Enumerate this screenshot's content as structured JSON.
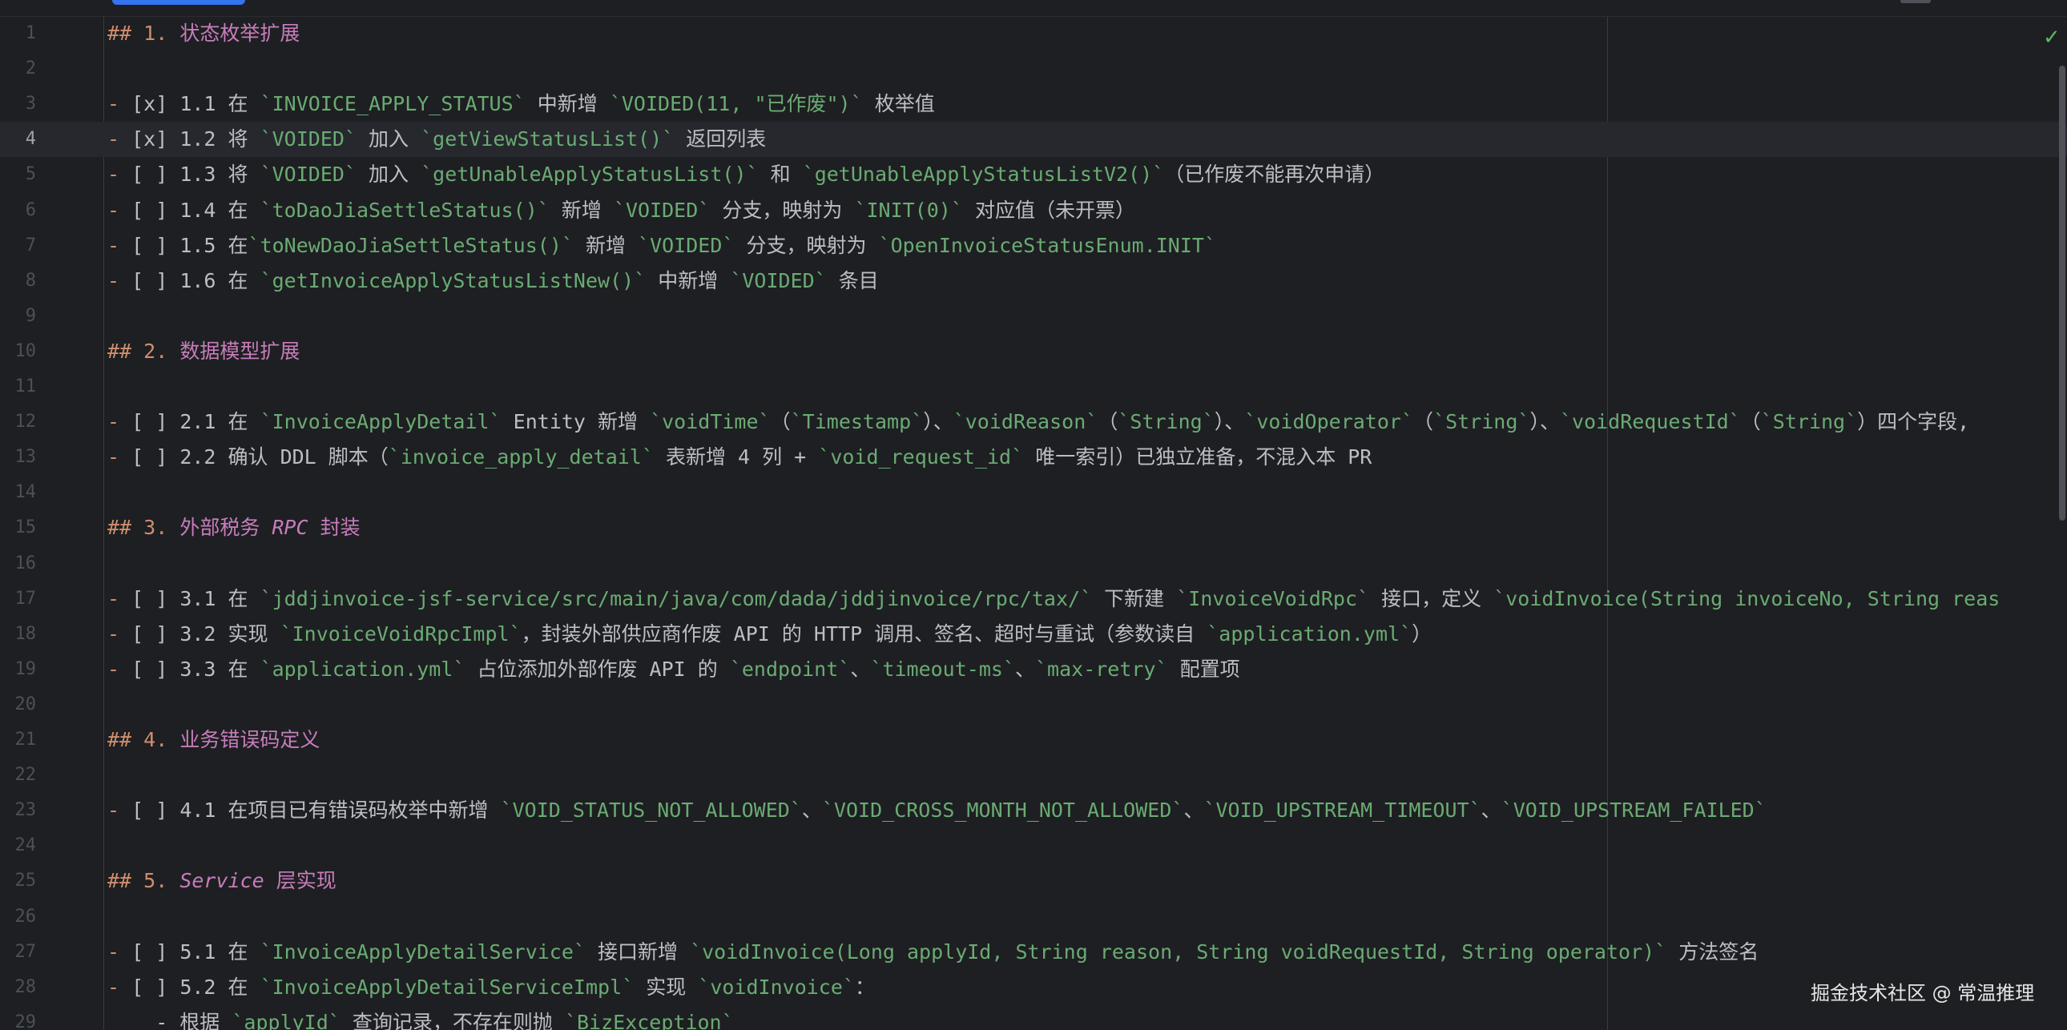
{
  "editor": {
    "lines": [
      {
        "n": "1",
        "parts": [
          {
            "c": "h",
            "t": "## 1. "
          },
          {
            "c": "hh",
            "t": "状态枚举扩展"
          }
        ]
      },
      {
        "n": "2",
        "parts": []
      },
      {
        "n": "3",
        "parts": [
          {
            "c": "b",
            "t": "- "
          },
          {
            "c": "t",
            "t": "[x] 1.1 在 "
          },
          {
            "c": "s",
            "t": "`INVOICE_APPLY_STATUS`"
          },
          {
            "c": "t",
            "t": " 中新增 "
          },
          {
            "c": "s",
            "t": "`VOIDED(11, \"已作废\")`"
          },
          {
            "c": "t",
            "t": " 枚举值"
          }
        ]
      },
      {
        "n": "4",
        "current": true,
        "parts": [
          {
            "c": "b",
            "t": "- "
          },
          {
            "c": "t",
            "t": "[x] 1.2 将 "
          },
          {
            "c": "s",
            "t": "`VOIDED`"
          },
          {
            "c": "t",
            "t": " 加入 "
          },
          {
            "c": "s",
            "t": "`getViewStatusList()`"
          },
          {
            "c": "t",
            "t": " 返回列表"
          }
        ]
      },
      {
        "n": "5",
        "parts": [
          {
            "c": "b",
            "t": "- "
          },
          {
            "c": "t",
            "t": "[ ] 1.3 将 "
          },
          {
            "c": "s",
            "t": "`VOIDED`"
          },
          {
            "c": "t",
            "t": " 加入 "
          },
          {
            "c": "s",
            "t": "`getUnableApplyStatusList()`"
          },
          {
            "c": "t",
            "t": " 和 "
          },
          {
            "c": "s",
            "t": "`getUnableApplyStatusListV2()`"
          },
          {
            "c": "t",
            "t": "（已作废不能再次申请）"
          }
        ]
      },
      {
        "n": "6",
        "parts": [
          {
            "c": "b",
            "t": "- "
          },
          {
            "c": "t",
            "t": "[ ] 1.4 在 "
          },
          {
            "c": "s",
            "t": "`toDaoJiaSettleStatus()`"
          },
          {
            "c": "t",
            "t": " 新增 "
          },
          {
            "c": "s",
            "t": "`VOIDED`"
          },
          {
            "c": "t",
            "t": " 分支，映射为 "
          },
          {
            "c": "s",
            "t": "`INIT(0)`"
          },
          {
            "c": "t",
            "t": " 对应值（未开票）"
          }
        ]
      },
      {
        "n": "7",
        "parts": [
          {
            "c": "b",
            "t": "- "
          },
          {
            "c": "t",
            "t": "[ ] 1.5 在"
          },
          {
            "c": "s",
            "t": "`toNewDaoJiaSettleStatus()`"
          },
          {
            "c": "t",
            "t": " 新增 "
          },
          {
            "c": "s",
            "t": "`VOIDED`"
          },
          {
            "c": "t",
            "t": " 分支，映射为 "
          },
          {
            "c": "s",
            "t": "`OpenInvoiceStatusEnum.INIT`"
          }
        ]
      },
      {
        "n": "8",
        "parts": [
          {
            "c": "b",
            "t": "- "
          },
          {
            "c": "t",
            "t": "[ ] 1.6 在 "
          },
          {
            "c": "s",
            "t": "`getInvoiceApplyStatusListNew()`"
          },
          {
            "c": "t",
            "t": " 中新增 "
          },
          {
            "c": "s",
            "t": "`VOIDED`"
          },
          {
            "c": "t",
            "t": " 条目"
          }
        ]
      },
      {
        "n": "9",
        "parts": []
      },
      {
        "n": "10",
        "parts": [
          {
            "c": "h",
            "t": "## 2. "
          },
          {
            "c": "hh",
            "t": "数据模型扩展"
          }
        ]
      },
      {
        "n": "11",
        "parts": []
      },
      {
        "n": "12",
        "parts": [
          {
            "c": "b",
            "t": "- "
          },
          {
            "c": "t",
            "t": "[ ] 2.1 在 "
          },
          {
            "c": "s",
            "t": "`InvoiceApplyDetail`"
          },
          {
            "c": "t",
            "t": " Entity 新增 "
          },
          {
            "c": "s",
            "t": "`voidTime`"
          },
          {
            "c": "t",
            "t": "（"
          },
          {
            "c": "s",
            "t": "`Timestamp`"
          },
          {
            "c": "t",
            "t": "）、"
          },
          {
            "c": "s",
            "t": "`voidReason`"
          },
          {
            "c": "t",
            "t": "（"
          },
          {
            "c": "s",
            "t": "`String`"
          },
          {
            "c": "t",
            "t": "）、"
          },
          {
            "c": "s",
            "t": "`voidOperator`"
          },
          {
            "c": "t",
            "t": "（"
          },
          {
            "c": "s",
            "t": "`String`"
          },
          {
            "c": "t",
            "t": "）、"
          },
          {
            "c": "s",
            "t": "`voidRequestId`"
          },
          {
            "c": "t",
            "t": "（"
          },
          {
            "c": "s",
            "t": "`String`"
          },
          {
            "c": "t",
            "t": "）四个字段,"
          }
        ]
      },
      {
        "n": "13",
        "parts": [
          {
            "c": "b",
            "t": "- "
          },
          {
            "c": "t",
            "t": "[ ] 2.2 确认 DDL 脚本（"
          },
          {
            "c": "s",
            "t": "`invoice_apply_detail`"
          },
          {
            "c": "t",
            "t": " 表新增 4 列 + "
          },
          {
            "c": "s",
            "t": "`void_request_id`"
          },
          {
            "c": "t",
            "t": " 唯一索引）已独立准备，不混入本 PR"
          }
        ]
      },
      {
        "n": "14",
        "parts": []
      },
      {
        "n": "15",
        "parts": [
          {
            "c": "h",
            "t": "## 3. "
          },
          {
            "c": "hh",
            "t": "外部税务 "
          },
          {
            "c": "hi",
            "t": "RPC"
          },
          {
            "c": "hh",
            "t": " 封装"
          }
        ]
      },
      {
        "n": "16",
        "parts": []
      },
      {
        "n": "17",
        "parts": [
          {
            "c": "b",
            "t": "- "
          },
          {
            "c": "t",
            "t": "[ ] 3.1 在 "
          },
          {
            "c": "s",
            "t": "`jddjinvoice-jsf-service/src/main/java/com/dada/jddjinvoice/rpc/tax/`"
          },
          {
            "c": "t",
            "t": " 下新建 "
          },
          {
            "c": "s",
            "t": "`InvoiceVoidRpc`"
          },
          {
            "c": "t",
            "t": " 接口，定义 "
          },
          {
            "c": "s",
            "t": "`voidInvoice(String invoiceNo, String reas"
          }
        ]
      },
      {
        "n": "18",
        "parts": [
          {
            "c": "b",
            "t": "- "
          },
          {
            "c": "t",
            "t": "[ ] 3.2 实现 "
          },
          {
            "c": "s",
            "t": "`InvoiceVoidRpcImpl`"
          },
          {
            "c": "t",
            "t": "，封装外部供应商作废 API 的 HTTP 调用、签名、超时与重试（参数读自 "
          },
          {
            "c": "s",
            "t": "`application.yml`"
          },
          {
            "c": "t",
            "t": "）"
          }
        ]
      },
      {
        "n": "19",
        "parts": [
          {
            "c": "b",
            "t": "- "
          },
          {
            "c": "t",
            "t": "[ ] 3.3 在 "
          },
          {
            "c": "s",
            "t": "`application.yml`"
          },
          {
            "c": "t",
            "t": " 占位添加外部作废 API 的 "
          },
          {
            "c": "s",
            "t": "`endpoint`"
          },
          {
            "c": "t",
            "t": "、"
          },
          {
            "c": "s",
            "t": "`timeout-ms`"
          },
          {
            "c": "t",
            "t": "、"
          },
          {
            "c": "s",
            "t": "`max-retry`"
          },
          {
            "c": "t",
            "t": " 配置项"
          }
        ]
      },
      {
        "n": "20",
        "parts": []
      },
      {
        "n": "21",
        "parts": [
          {
            "c": "h",
            "t": "## 4. "
          },
          {
            "c": "hh",
            "t": "业务错误码定义"
          }
        ]
      },
      {
        "n": "22",
        "parts": []
      },
      {
        "n": "23",
        "parts": [
          {
            "c": "b",
            "t": "- "
          },
          {
            "c": "t",
            "t": "[ ] 4.1 在项目已有错误码枚举中新增 "
          },
          {
            "c": "s",
            "t": "`VOID_STATUS_NOT_ALLOWED`"
          },
          {
            "c": "t",
            "t": "、"
          },
          {
            "c": "s",
            "t": "`VOID_CROSS_MONTH_NOT_ALLOWED`"
          },
          {
            "c": "t",
            "t": "、"
          },
          {
            "c": "s",
            "t": "`VOID_UPSTREAM_TIMEOUT`"
          },
          {
            "c": "t",
            "t": "、"
          },
          {
            "c": "s",
            "t": "`VOID_UPSTREAM_FAILED`"
          }
        ]
      },
      {
        "n": "24",
        "parts": []
      },
      {
        "n": "25",
        "parts": [
          {
            "c": "h",
            "t": "## 5. "
          },
          {
            "c": "hi",
            "t": "Service"
          },
          {
            "c": "hh",
            "t": " 层实现"
          }
        ]
      },
      {
        "n": "26",
        "parts": []
      },
      {
        "n": "27",
        "parts": [
          {
            "c": "b",
            "t": "- "
          },
          {
            "c": "t",
            "t": "[ ] 5.1 在 "
          },
          {
            "c": "s",
            "t": "`InvoiceApplyDetailService`"
          },
          {
            "c": "t",
            "t": " 接口新增 "
          },
          {
            "c": "s",
            "t": "`voidInvoice(Long applyId, String reason, String voidRequestId, String operator)`"
          },
          {
            "c": "t",
            "t": " 方法签名"
          }
        ]
      },
      {
        "n": "28",
        "parts": [
          {
            "c": "b",
            "t": "- "
          },
          {
            "c": "t",
            "t": "[ ] 5.2 在 "
          },
          {
            "c": "s",
            "t": "`InvoiceApplyDetailServiceImpl`"
          },
          {
            "c": "t",
            "t": " 实现 "
          },
          {
            "c": "s",
            "t": "`voidInvoice`"
          },
          {
            "c": "t",
            "t": "："
          }
        ]
      },
      {
        "n": "29",
        "parts": [
          {
            "c": "t",
            "t": "    - 根据 "
          },
          {
            "c": "s",
            "t": "`applyId`"
          },
          {
            "c": "t",
            "t": " 查询记录，不存在则抛 "
          },
          {
            "c": "s",
            "t": "`BizException`"
          }
        ]
      }
    ]
  },
  "watermark": "掘金技术社区 @ 常温推理",
  "colors": {
    "background": "#1e1f22",
    "heading_marker": "#cf8e6d",
    "heading_text": "#c77dbb",
    "inline_code": "#6aab73",
    "text": "#bcbec4",
    "line_number": "#4b5059"
  }
}
